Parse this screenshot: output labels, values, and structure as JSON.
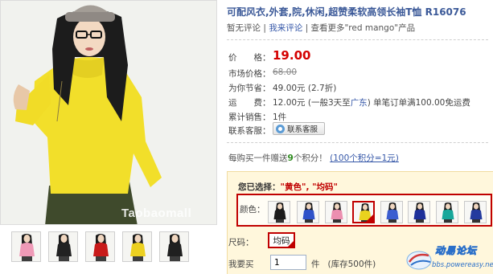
{
  "product": {
    "title": "可配风衣,外套,院,休闲,超赞柔软高领长袖T恤 R16076",
    "no_comment": "暂无评论",
    "write_comment": "我来评论",
    "more_text": "查看更多\"red mango\"产品",
    "sep": "|",
    "photo_watermark": "Taobaomall"
  },
  "fields": {
    "price_label": "价　　格：",
    "price_value": "19.00",
    "market_label": "市场价格：",
    "market_value": "68.00",
    "saving_label": "为你节省：",
    "saving_value": "49.00元 (2.7折)",
    "shipping_label": "运　　费：",
    "shipping_value_a": "12.00元 (一般3天至",
    "shipping_city": "广东",
    "shipping_value_b": ") 单笔订单满100.00免运费",
    "sales_label": "累计销售：",
    "sales_value": "1件",
    "service_label": "联系客服：",
    "service_button": "联系客服"
  },
  "points": {
    "text_a": "每购买一件赠送",
    "count": "9",
    "text_b": "个积分！",
    "link": "(100个积分=1元)"
  },
  "selection": {
    "chosen_label": "您已选择：",
    "chosen_value": "\"黄色\", \"均码\"",
    "color_label": "颜色：",
    "size_label": "尺码：",
    "size_value": "均码",
    "qty_label": "我要买",
    "qty_value": "1",
    "qty_unit": "件",
    "stock": "(库存500件)"
  },
  "swatches": [
    {
      "color": "#1b1b1b",
      "selected": false
    },
    {
      "color": "#2f52c9",
      "selected": false
    },
    {
      "color": "#ec8fb0",
      "selected": false
    },
    {
      "color": "#e9d21e",
      "selected": true
    },
    {
      "color": "#3b5dd0",
      "selected": false
    },
    {
      "color": "#1d2f9a",
      "selected": false
    },
    {
      "color": "#17a79a",
      "selected": false
    },
    {
      "color": "#243b9e",
      "selected": false
    }
  ],
  "thumbnails": [
    {
      "color": "#ef9ab7"
    },
    {
      "color": "#222222"
    },
    {
      "color": "#c81a1a"
    },
    {
      "color": "#ecd020"
    },
    {
      "color": "#202020"
    }
  ],
  "watermark": {
    "title": "动易论坛",
    "url": "bbs.powereasy.net"
  },
  "colors": {
    "link": "#3557a8",
    "price": "#d40000",
    "accent_border": "#c00000",
    "panel_bg": "#fff7dc",
    "green_points": "#2e8b1e",
    "shirt_yellow": "#f2df2a"
  }
}
